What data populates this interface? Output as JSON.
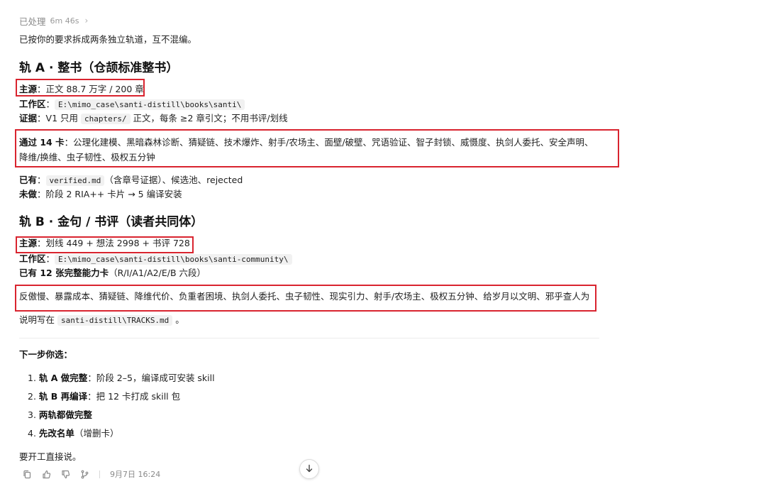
{
  "status": {
    "label": "已处理",
    "duration": "6m 46s"
  },
  "intro": "已按你的要求拆成两条独立轨道，互不混编。",
  "track_a": {
    "heading": "轨 A · 整书（仓颉标准整书）",
    "source_label": "主源",
    "source_value": "：正文 88.7 万字 / 200 章",
    "workspace_label": "工作区",
    "workspace_sep": "：",
    "workspace_path": "E:\\mimo_case\\santi-distill\\books\\santi\\",
    "evidence_label": "证据",
    "evidence_pre": "：V1 只用 ",
    "evidence_code": "chapters/",
    "evidence_post": " 正文，每条 ≥2 章引文；不用书评/划线",
    "passed_label": "通过 14 卡",
    "passed_value": "：公理化建模、黑暗森林诊断、猜疑链、技术爆炸、射手/农场主、面壁/破壁、咒语验证、智子封锁、威慑度、执剑人委托、安全声明、降维/换维、虫子韧性、极权五分钟",
    "have_label": "已有",
    "have_sep": "：",
    "have_code": "verified.md",
    "have_post": "（含章号证据）、候选池、rejected",
    "todo_label": "未做",
    "todo_value": "：阶段 2 RIA++ 卡片 → 5 编译安装"
  },
  "track_b": {
    "heading": "轨 B · 金句 / 书评（读者共同体）",
    "source_label": "主源",
    "source_value": "：划线 449 + 想法 2998 + 书评 728",
    "workspace_label": "工作区",
    "workspace_sep": "：",
    "workspace_path": "E:\\mimo_case\\santi-distill\\books\\santi-community\\",
    "cards_label": "已有 12 张完整能力卡",
    "cards_value": "（R/I/A1/A2/E/B 六段）",
    "cards_list": "反傲慢、暴露成本、猜疑链、降维代价、负重者困境、执剑人委托、虫子韧性、现实引力、射手/农场主、极权五分钟、给岁月以文明、邪乎查人为"
  },
  "note_pre": "说明写在 ",
  "note_code": "santi-distill\\TRACKS.md",
  "note_post": " 。",
  "next_heading": "下一步你选：",
  "options": [
    {
      "num": "1.",
      "label": "轨 A 做完整",
      "desc": "：阶段 2–5，编译成可安装 skill"
    },
    {
      "num": "2.",
      "label": "轨 B 再编译",
      "desc": "：把 12 卡打成 skill 包"
    },
    {
      "num": "3.",
      "label": "两轨都做完整",
      "desc": ""
    },
    {
      "num": "4.",
      "label": "先改名单",
      "desc": "（增删卡）"
    }
  ],
  "closing": "要开工直接说。",
  "footer": {
    "timestamp": "9月7日 16:24"
  },
  "colors": {
    "highlight_box": "#d9242f",
    "muted_text": "#8a8a8a",
    "code_bg": "#f1f1f1"
  }
}
